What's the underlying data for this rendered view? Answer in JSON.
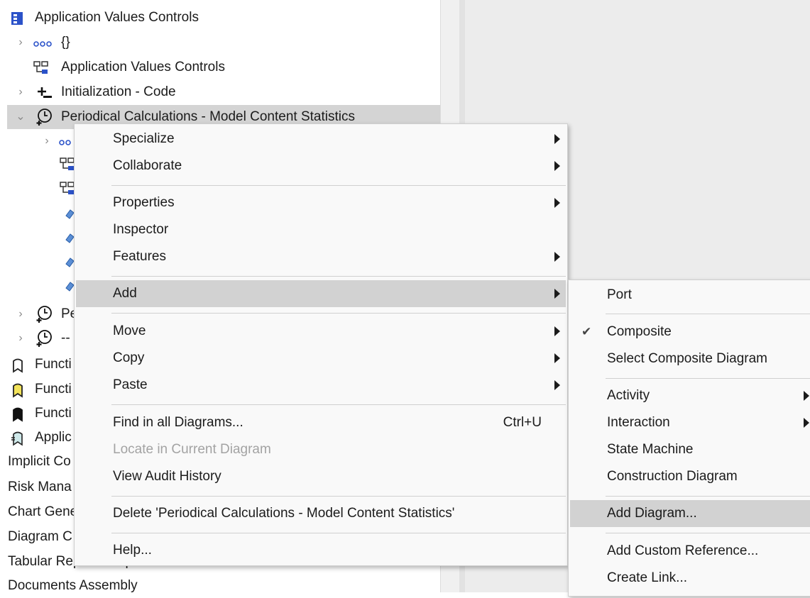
{
  "tree": {
    "rows": [
      {
        "label": "Application Values Controls"
      },
      {
        "label": "{}"
      },
      {
        "label": "Application Values Controls"
      },
      {
        "label": "Initialization - Code"
      },
      {
        "label": "Periodical Calculations - Model Content Statistics"
      },
      {
        "label": "Pe"
      },
      {
        "label": "--"
      },
      {
        "label": "Functi"
      },
      {
        "label": "Functi"
      },
      {
        "label": "Functi"
      },
      {
        "label": "Applic"
      },
      {
        "label": "Implicit Co"
      },
      {
        "label": "Risk Mana"
      },
      {
        "label": "Chart Gene"
      },
      {
        "label": "Diagram C"
      },
      {
        "label": "Tabular Report Templates"
      },
      {
        "label": "Documents Assembly"
      }
    ]
  },
  "context_menu": {
    "items": {
      "specialize": "Specialize",
      "collaborate": "Collaborate",
      "properties": "Properties",
      "inspector": "Inspector",
      "features": "Features",
      "add": "Add",
      "move": "Move",
      "copy": "Copy",
      "paste": "Paste",
      "find_in_all_diagrams": "Find in all Diagrams...",
      "find_shortcut": "Ctrl+U",
      "locate_in_current_diagram": "Locate in Current Diagram",
      "view_audit_history": "View Audit History",
      "delete": "Delete 'Periodical Calculations - Model Content Statistics'",
      "help": "Help..."
    }
  },
  "add_submenu": {
    "items": {
      "port": "Port",
      "composite": "Composite",
      "select_composite_diagram": "Select Composite Diagram",
      "activity": "Activity",
      "interaction": "Interaction",
      "state_machine": "State Machine",
      "construction_diagram": "Construction Diagram",
      "add_diagram": "Add Diagram...",
      "add_custom_reference": "Add Custom Reference...",
      "create_link": "Create Link..."
    },
    "composite_checked": true
  },
  "colors": {
    "selection": "#d4d4d4",
    "menu_bg": "#f9f9f9",
    "menu_highlight": "#d2d2d2",
    "right_pane": "#ececec",
    "package_icon": "#2b52c9"
  }
}
